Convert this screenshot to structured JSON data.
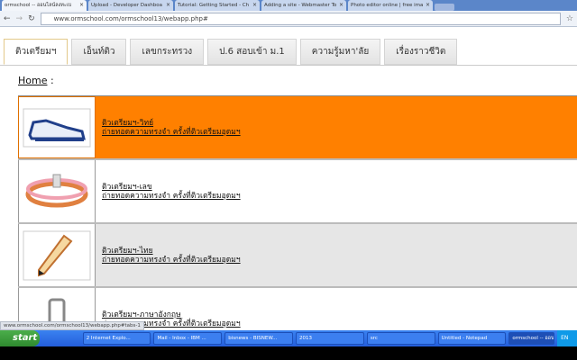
{
  "browser_tabs": [
    {
      "label": "ormschool -- ออนไลน์ลงทะเบ"
    },
    {
      "label": "Upload - Developer Dashboa"
    },
    {
      "label": "Tutorial: Getting Started - Ch"
    },
    {
      "label": "Adding a site - Webmaster To"
    },
    {
      "label": "Photo editor online | free ima"
    }
  ],
  "address": {
    "url": "www.ormschool.com/ormschool13/webapp.php#"
  },
  "tabs": [
    "ติวเตรียมฯ",
    "เอ็นท์ติว",
    "เลขกระทรวง",
    "ป.6 สอบเข้า ม.1",
    "ความรู้มหา'ลัย",
    "เรื่องราวชีวิต"
  ],
  "breadcrumb": {
    "home": "Home",
    "sep": " :"
  },
  "items": [
    {
      "title": "ติวเตรียมฯ-วิทย์",
      "subtitle": "ถ่ายทอดความทรงจำ ครั้งที่ติวเตรียมอุดมฯ",
      "icon": "shoe-icon"
    },
    {
      "title": "ติวเตรียมฯ-เลข",
      "subtitle": "ถ่ายทอดความทรงจำ ครั้งที่ติวเตรียมอุดมฯ",
      "icon": "bracelet-icon"
    },
    {
      "title": "ติวเตรียมฯ-ไทย",
      "subtitle": "ถ่ายทอดความทรงจำ ครั้งที่ติวเตรียมอุดมฯ",
      "icon": "pencil-icon"
    },
    {
      "title": "ติวเตรียมฯ-ภาษาอังกฤษ",
      "subtitle": "ถ่ายทอดความทรงจำ ครั้งที่ติวเตรียมอุดมฯ",
      "icon": "eraser-icon"
    }
  ],
  "status": "www.ormschool.com/ormschool13/webapp.php#tabs-1",
  "taskbar": {
    "start": "start",
    "tasks": [
      "2 Internet Explo...",
      "Mail - Inbox - IBM ...",
      "bisnews - BISNEW...",
      "2013",
      "src",
      "Untitled - Notepad",
      "ormschool -- ออนไ..."
    ],
    "tray": "EN"
  }
}
